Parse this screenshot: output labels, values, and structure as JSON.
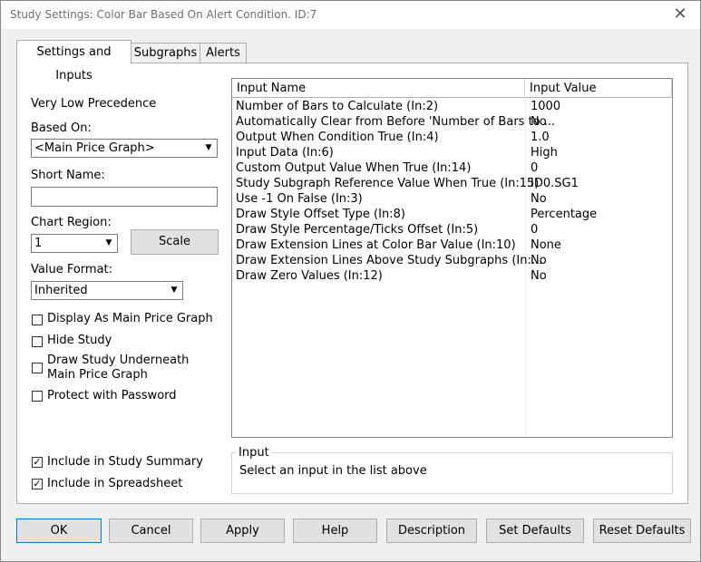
{
  "window": {
    "title": "Study Settings: Color Bar Based On Alert Condition. ID:7",
    "close_glyph": "✕"
  },
  "tabs": [
    {
      "label": "Settings and Inputs",
      "active": true
    },
    {
      "label": "Subgraphs",
      "active": false
    },
    {
      "label": "Alerts",
      "active": false
    }
  ],
  "left": {
    "precedence": "Very Low Precedence",
    "based_on_label": "Based On:",
    "based_on_value": "<Main Price Graph>",
    "short_name_label": "Short Name:",
    "short_name_value": "",
    "chart_region_label": "Chart Region:",
    "chart_region_value": "1",
    "scale_button": "Scale",
    "value_format_label": "Value Format:",
    "value_format_value": "Inherited",
    "checkboxes": [
      {
        "label": "Display As Main Price Graph",
        "checked": false
      },
      {
        "label": "Hide Study",
        "checked": false
      },
      {
        "label": "Draw Study Underneath",
        "label2": "Main Price Graph",
        "checked": false
      },
      {
        "label": "Protect with Password",
        "checked": false
      }
    ],
    "bottom_checkboxes": [
      {
        "label": "Include in Study Summary",
        "checked": true
      },
      {
        "label": "Include in Spreadsheet",
        "checked": true
      }
    ]
  },
  "inputs_table": {
    "headers": [
      "Input Name",
      "Input Value"
    ],
    "rows": [
      {
        "name": "Number of Bars to Calculate  (In:2)",
        "value": "1000"
      },
      {
        "name": "Automatically Clear from Before 'Number of Bars to ...",
        "value": "No"
      },
      {
        "name": "Output When Condition True  (In:4)",
        "value": "1.0"
      },
      {
        "name": "Input Data  (In:6)",
        "value": "High"
      },
      {
        "name": "Custom Output Value When True  (In:14)",
        "value": "0"
      },
      {
        "name": "Study Subgraph Reference Value When True  (In:15)",
        "value": "ID0.SG1"
      },
      {
        "name": "Use -1 On False  (In:3)",
        "value": "No"
      },
      {
        "name": "Draw Style Offset Type  (In:8)",
        "value": "Percentage"
      },
      {
        "name": "Draw Style Percentage/Ticks Offset  (In:5)",
        "value": "0"
      },
      {
        "name": "Draw Extension Lines at Color Bar Value  (In:10)",
        "value": "None"
      },
      {
        "name": "Draw Extension Lines Above Study Subgraphs  (In:...",
        "value": "No"
      },
      {
        "name": "Draw Zero Values  (In:12)",
        "value": "No"
      }
    ]
  },
  "input_group": {
    "label": "Input",
    "text": "Select an input in the list above"
  },
  "buttons": [
    "OK",
    "Cancel",
    "Apply",
    "Help",
    "Description",
    "Set Defaults",
    "Reset Defaults"
  ]
}
